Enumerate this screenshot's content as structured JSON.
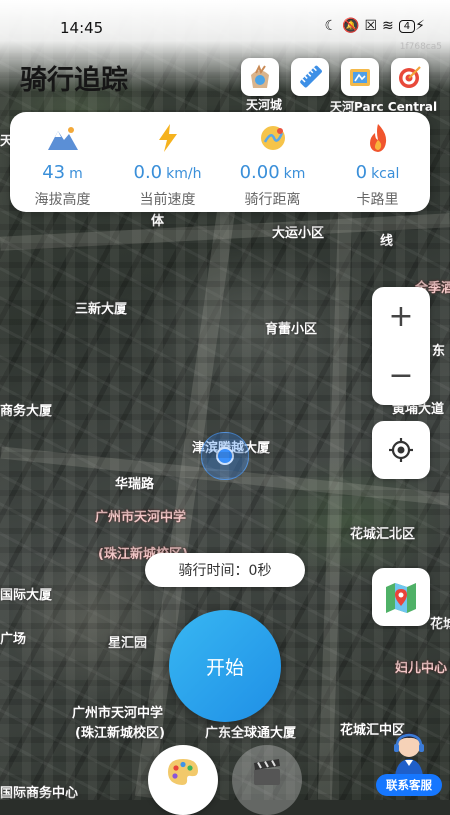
{
  "status_bar": {
    "time": "14:45",
    "battery": "4"
  },
  "build_id": "1f768ca5",
  "app": {
    "title": "骑行追踪"
  },
  "toolbar": {
    "icons": [
      "bag-icon",
      "ruler-icon",
      "map-book-icon",
      "target-icon"
    ]
  },
  "stats": [
    {
      "icon": "mountain-icon",
      "value": "43",
      "unit": "m",
      "label": "海拔高度"
    },
    {
      "icon": "lightning-icon",
      "value": "0.0",
      "unit": "km/h",
      "label": "当前速度"
    },
    {
      "icon": "route-icon",
      "value": "0.00",
      "unit": "km",
      "label": "骑行距离"
    },
    {
      "icon": "flame-icon",
      "value": "0",
      "unit": "kcal",
      "label": "卡路里"
    }
  ],
  "map_labels": {
    "l1": "三新大厦",
    "l2": "育蕾小区",
    "l3": "大运小区",
    "l4": "商务大厦",
    "l5": "津滨腾越大厦",
    "l6": "华瑞路",
    "l7": "广州市天河中学",
    "l8": "(珠江新城校区)",
    "l9": "花城汇北区",
    "l10": "国际大厦",
    "l11": "广场",
    "l12": "星汇园",
    "l13": "广州市天河中学",
    "l14": "(珠江新城校区)",
    "l15": "广东全球通大厦",
    "l16": "花城汇中区",
    "l17": "妇儿中心",
    "l18": "国际商务中心",
    "l19": "天河Parc Central",
    "l20": "天河城",
    "l21": "全季酒店",
    "l22": "黄埔大道",
    "l23": "花城汇南区",
    "l24": "天",
    "l25": "线",
    "l26": "体",
    "l27": "东"
  },
  "zoom": {
    "in": "+",
    "out": "−"
  },
  "ride_time": "骑行时间：0秒",
  "start_button": "开始",
  "customer_service": "联系客服"
}
